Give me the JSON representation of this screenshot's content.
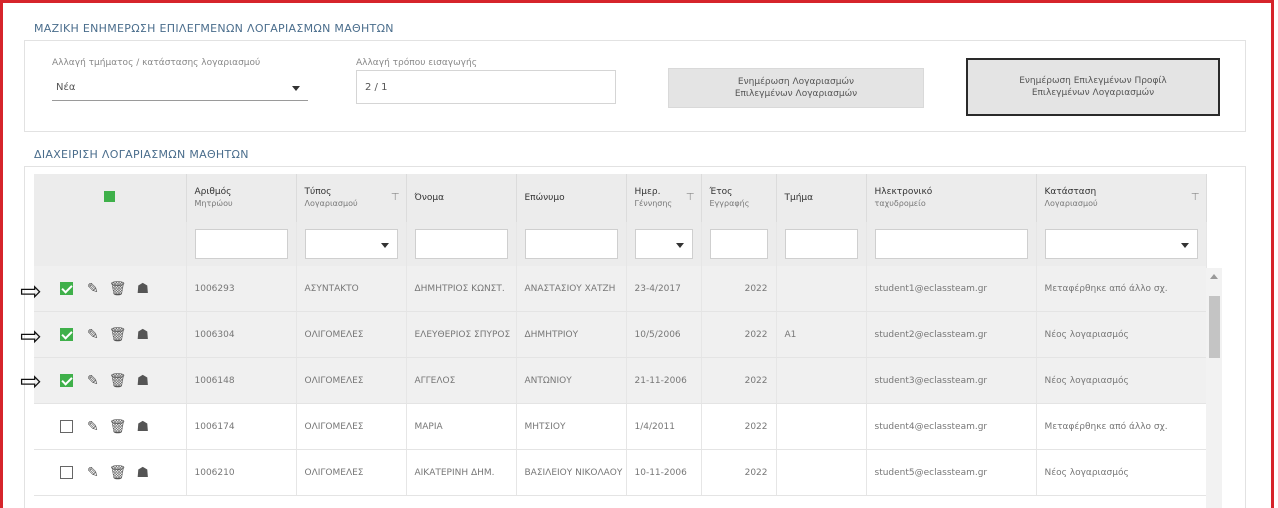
{
  "bulk_update": {
    "title": "ΜΑΖΙΚΗ ΕΝΗΜΕΡΩΣΗ ΕΠΙΛΕΓΜΕΝΩΝ ΛΟΓΑΡΙΑΣΜΩΝ ΜΑΘΗΤΩΝ",
    "field1_label": "Αλλαγή τμήματος / κατάστασης λογαριασμού",
    "field1_value": "Νέα",
    "field2_label": "Αλλαγή τρόπου εισαγωγής",
    "field2_value": "2 / 1",
    "button1_line1": "Ενημέρωση Λογαριασμών",
    "button1_line2": "Επιλεγμένων Λογαριασμών",
    "button2_line1": "Ενημέρωση Επιλεγμένων Προφίλ",
    "button2_line2": "Επιλεγμένων Λογαριασμών"
  },
  "management": {
    "title": "ΔΙΑΧΕΙΡΙΣΗ ΛΟΓΑΡΙΑΣΜΩΝ ΜΑΘΗΤΩΝ"
  },
  "table": {
    "headers": [
      {
        "line1": "Αριθμός",
        "line2": "Μητρώου"
      },
      {
        "line1": "Τύπος",
        "line2": "Λογαριασμού"
      },
      {
        "line1": "Όνομα",
        "line2": ""
      },
      {
        "line1": "Επώνυμο",
        "line2": ""
      },
      {
        "line1": "Ημερ.",
        "line2": "Γέννησης"
      },
      {
        "line1": "Έτος",
        "line2": "Εγγραφής"
      },
      {
        "line1": "Τμήμα",
        "line2": ""
      },
      {
        "line1": "Ηλεκτρονικό",
        "line2": "ταχυδρομείο"
      },
      {
        "line1": "Κατάσταση",
        "line2": "Λογαριασμού"
      }
    ],
    "rows": [
      {
        "checked": true,
        "arrow": true,
        "am": "1006293",
        "type": "ΑΣΥΝΤΑΚΤΟ",
        "name": "ΔΗΜΗΤΡΙΟΣ ΚΩΝΣΤ.",
        "surname": "ΑΝΑΣΤΑΣΙΟΥ ΧΑΤΖΗ",
        "birth": "23-4/2017",
        "year": "2022",
        "class": "",
        "email": "student1@eclassteam.gr",
        "status": "Μεταφέρθηκε από άλλο σχ."
      },
      {
        "checked": true,
        "arrow": true,
        "am": "1006304",
        "type": "ΟΛΙΓΟΜΕΛΕΣ",
        "name": "ΕΛΕΥΘΕΡΙΟΣ ΣΠΥΡΟΣ",
        "surname": "ΔΗΜΗΤΡΙΟΥ",
        "birth": "10/5/2006",
        "year": "2022",
        "class": "Α1",
        "email": "student2@eclassteam.gr",
        "status": "Νέος λογαριασμός"
      },
      {
        "checked": true,
        "arrow": true,
        "am": "1006148",
        "type": "ΟΛΙΓΟΜΕΛΕΣ",
        "name": "ΑΓΓΕΛΟΣ",
        "surname": "ΑΝΤΩΝΙΟΥ",
        "birth": "21-11-2006",
        "year": "2022",
        "class": "",
        "email": "student3@eclassteam.gr",
        "status": "Νέος λογαριασμός"
      },
      {
        "checked": false,
        "arrow": false,
        "am": "1006174",
        "type": "ΟΛΙΓΟΜΕΛΕΣ",
        "name": "ΜΑΡΙΑ",
        "surname": "ΜΗΤΣΙΟΥ",
        "birth": "1/4/2011",
        "year": "2022",
        "class": "",
        "email": "student4@eclassteam.gr",
        "status": "Μεταφέρθηκε από άλλο σχ."
      },
      {
        "checked": false,
        "arrow": false,
        "am": "1006210",
        "type": "ΟΛΙΓΟΜΕΛΕΣ",
        "name": "ΑΙΚΑΤΕΡΙΝΗ ΔΗΜ.",
        "surname": "ΒΑΣΙΛΕΙΟΥ ΝΙΚΟΛΑΟΥ",
        "birth": "10-11-2006",
        "year": "2022",
        "class": "",
        "email": "student5@eclassteam.gr",
        "status": "Νέος λογαριασμός"
      }
    ]
  },
  "icons": {
    "edit": "✎",
    "delete": "🗑",
    "profile": "☗",
    "arrow": "⇨",
    "funnel": "⊤"
  }
}
